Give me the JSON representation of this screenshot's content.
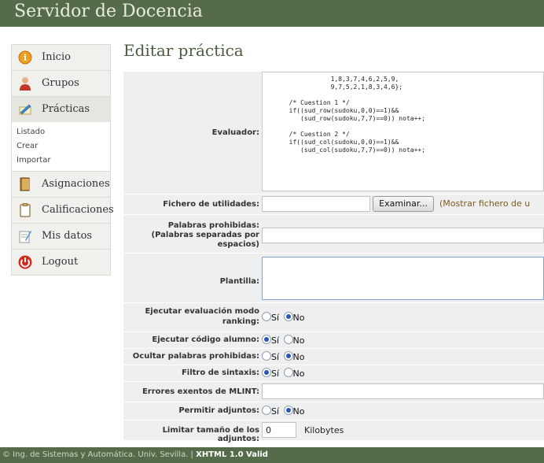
{
  "app_title": "Servidor de Docencia",
  "sidebar": {
    "items": [
      {
        "label": "Inicio",
        "icon": "info-icon"
      },
      {
        "label": "Grupos",
        "icon": "users-icon"
      },
      {
        "label": "Prácticas",
        "icon": "edit-icon"
      },
      {
        "label": "Asignaciones",
        "icon": "book-icon"
      },
      {
        "label": "Calificaciones",
        "icon": "clipboard-icon"
      },
      {
        "label": "Mis datos",
        "icon": "notes-icon"
      },
      {
        "label": "Logout",
        "icon": "power-icon"
      }
    ],
    "practicas_sub": [
      "Listado",
      "Crear",
      "Importar"
    ]
  },
  "page_title": "Editar práctica",
  "form": {
    "evaluador_label": "Evaluador:",
    "evaluador_code": "             1,8,3,7,4,6,2,5,9,\n             9,7,5,2,1,8,3,4,6};\n\n  /* Cuestion 1 */\n  if((sud_row(sudoku,0,0)==1)&&\n     (sud_row(sudoku,7,7)==0)) nota++;\n\n  /* Cuestion 2 */\n  if((sud_col(sudoku,0,0)==1)&&\n     (sud_col(sudoku,7,7)==0)) nota++;",
    "fichero_label": "Fichero de utilidades:",
    "examinar_button": "Examinar...",
    "mostrar_link": "(Mostrar fichero de u",
    "palabras_label_1": "Palabras prohibidas:",
    "palabras_label_2": "(Palabras separadas por",
    "palabras_label_3": "espacios)",
    "plantilla_label": "Plantilla:",
    "ranking_label_1": "Ejecutar evaluación modo",
    "ranking_label_2": "ranking:",
    "codigo_label": "Ejecutar código alumno:",
    "ocultar_label": "Ocultar palabras prohibidas:",
    "filtro_label": "Filtro de sintaxis:",
    "errores_label": "Errores exentos de MLINT:",
    "adjuntos_label": "Permitir adjuntos:",
    "limitar_label": "Limitar tamaño de los adjuntos:",
    "limitar_value": "0",
    "limitar_unit": "Kilobytes",
    "opt_si": "Sí",
    "opt_no": "No",
    "ranking_value": "No",
    "codigo_value": "Sí",
    "ocultar_value": "No",
    "filtro_value": "Sí",
    "adjuntos_value": "No"
  },
  "footer": {
    "text": "© Ing. de Sistemas y Automática. Univ. Sevilla. | ",
    "valid": "XHTML 1.0 Valid"
  },
  "colors": {
    "header_bg": "#556b4a",
    "title": "#4b5c40",
    "accent_radio": "#2a56b8"
  }
}
